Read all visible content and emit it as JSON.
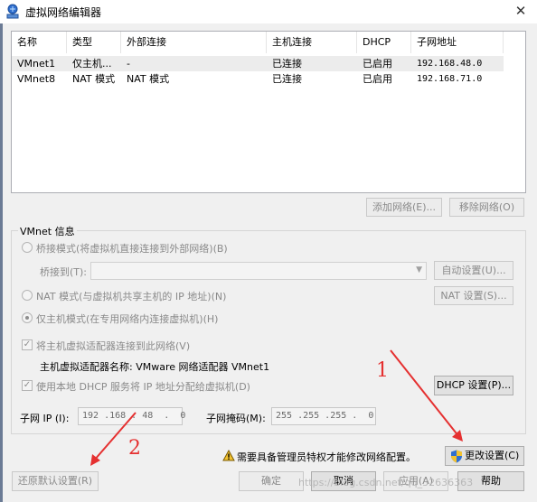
{
  "window": {
    "title": "虚拟网络编辑器",
    "close_glyph": "✕"
  },
  "table": {
    "headers": [
      "名称",
      "类型",
      "外部连接",
      "主机连接",
      "DHCP",
      "子网地址"
    ],
    "rows": [
      {
        "name": "VMnet1",
        "type": "仅主机...",
        "external": "-",
        "host": "已连接",
        "dhcp": "已启用",
        "subnet": "192.168.48.0",
        "selected": true
      },
      {
        "name": "VMnet8",
        "type": "NAT 模式",
        "external": "NAT 模式",
        "host": "已连接",
        "dhcp": "已启用",
        "subnet": "192.168.71.0",
        "selected": false
      }
    ]
  },
  "table_buttons": {
    "add": "添加网络(E)...",
    "remove": "移除网络(O)"
  },
  "vmnet_info": {
    "group_label": "VMnet 信息",
    "bridge_radio": "桥接模式(将虚拟机直接连接到外部网络)(B)",
    "bridge_to_label": "桥接到(T):",
    "auto_settings": "自动设置(U)...",
    "nat_radio": "NAT 模式(与虚拟机共享主机的 IP 地址)(N)",
    "nat_settings": "NAT 设置(S)...",
    "hostonly_radio": "仅主机模式(在专用网络内连接虚拟机)(H)",
    "connect_adapter_check": "将主机虚拟适配器连接到此网络(V)",
    "adapter_name_label": "主机虚拟适配器名称: VMware 网络适配器 VMnet1",
    "dhcp_check": "使用本地 DHCP 服务将 IP 地址分配给虚拟机(D)",
    "dhcp_settings": "DHCP 设置(P)...",
    "subnet_ip_label": "子网 IP (I):",
    "subnet_ip_value": "192 .168 . 48  .  0",
    "subnet_mask_label": "子网掩码(M):",
    "subnet_mask_value": "255 .255 .255 .  0",
    "selected_mode": "host-only"
  },
  "footer": {
    "warning_text": "需要具备管理员特权才能修改网络配置。",
    "change_settings": "更改设置(C)",
    "restore_defaults": "还原默认设置(R)",
    "ok": "确定",
    "cancel": "取消",
    "apply": "应用(A)",
    "help": "帮助"
  },
  "annotations": {
    "one": "1",
    "two": "2"
  },
  "watermark": "https://blog.csdn.net/qq_32636363",
  "colors": {
    "annotation_red": "#e53030",
    "shield_blue": "#2f6fd0",
    "shield_yellow": "#f2c230"
  }
}
